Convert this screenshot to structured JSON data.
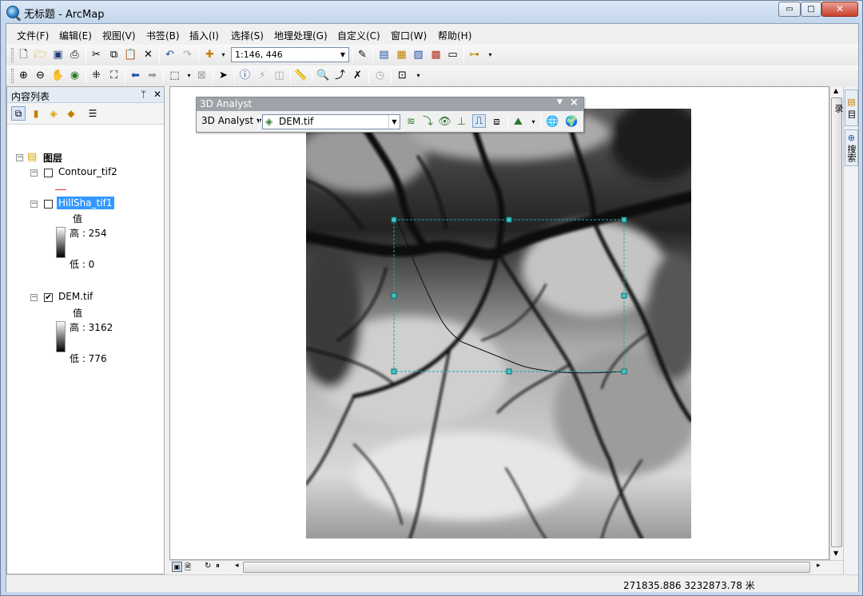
{
  "window": {
    "title": "无标题 - ArcMap",
    "min_icon": "▭",
    "max_icon": "□",
    "close_icon": "✕"
  },
  "menu": [
    {
      "label": "文件(F)"
    },
    {
      "label": "编辑(E)"
    },
    {
      "label": "视图(V)"
    },
    {
      "label": "书签(B)"
    },
    {
      "label": "插入(I)"
    },
    {
      "label": "选择(S)"
    },
    {
      "label": "地理处理(G)"
    },
    {
      "label": "自定义(C)"
    },
    {
      "label": "窗口(W)"
    },
    {
      "label": "帮助(H)"
    }
  ],
  "standard_toolbar": {
    "scale": "1:146, 446"
  },
  "toc": {
    "title": "内容列表",
    "pin": "ᛘ",
    "close": "✕",
    "group_label": "图层",
    "layers": [
      {
        "name": "Contour_tif2",
        "checked": false,
        "legend_color": "#e03030"
      },
      {
        "name": "HillSha_tif1",
        "checked": false,
        "selected": true,
        "value_header": "值",
        "high": "高 : 254",
        "low": "低 : 0"
      },
      {
        "name": "DEM.tif",
        "checked": true,
        "value_header": "值",
        "high": "高 : 3162",
        "low": "低 : 776"
      }
    ]
  },
  "analyst": {
    "title": "3D Analyst",
    "dropdown_label": "3D Analyst ▾",
    "layer": "DEM.tif"
  },
  "right_tabs": [
    "目录",
    "搜索"
  ],
  "status": {
    "coordinates": "271835.886  3232873.78 米"
  },
  "colors": {
    "selection": "#3399ff",
    "selection_box": "#26a6a6",
    "title_bar": "#c3d6ec"
  }
}
